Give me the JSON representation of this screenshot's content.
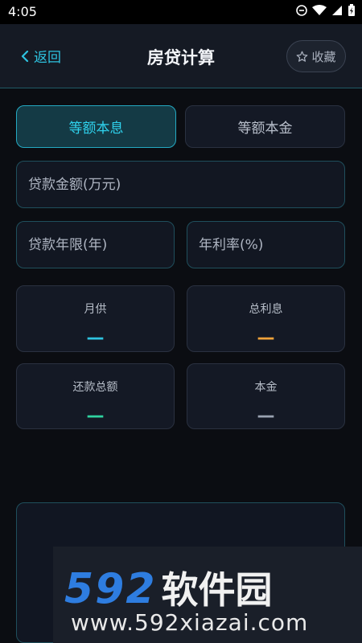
{
  "status_bar": {
    "time": "4:05"
  },
  "header": {
    "back_label": "返回",
    "title": "房贷计算",
    "favorite_label": "收藏"
  },
  "tabs": [
    {
      "label": "等额本息",
      "active": true
    },
    {
      "label": "等额本金",
      "active": false
    }
  ],
  "inputs": {
    "loan_amount": {
      "placeholder": "贷款金额(万元)",
      "value": ""
    },
    "loan_years": {
      "placeholder": "贷款年限(年)",
      "value": ""
    },
    "annual_rate": {
      "placeholder": "年利率(%)",
      "value": ""
    }
  },
  "results": {
    "monthly": {
      "label": "月供",
      "value": "—",
      "color": "#2ec3e0"
    },
    "total_interest": {
      "label": "总利息",
      "value": "—",
      "color": "#f0a23a"
    },
    "total_repayment": {
      "label": "还款总额",
      "value": "—",
      "color": "#2fd3a0"
    },
    "principal": {
      "label": "本金",
      "value": "—",
      "color": "#9aa3b2"
    }
  },
  "watermark": {
    "brand_number": "592",
    "brand_text": "软件园",
    "url": "www.592xiazai.com"
  }
}
